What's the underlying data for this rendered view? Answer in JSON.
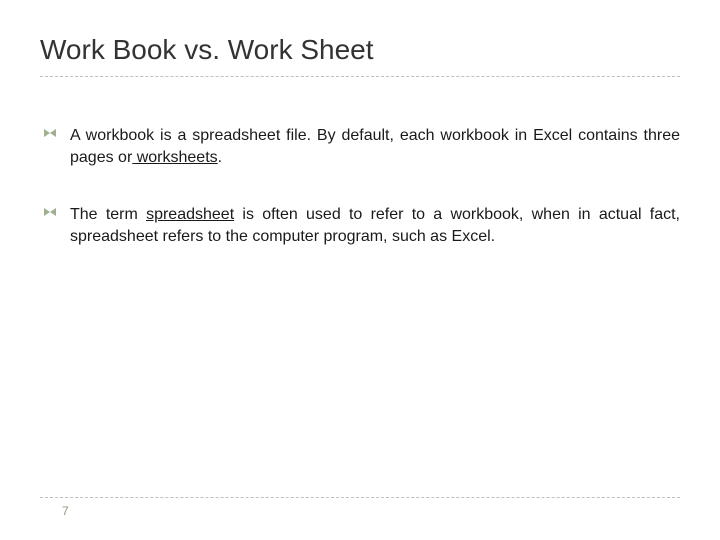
{
  "title": "Work Book vs. Work Sheet",
  "bullets": [
    {
      "pre": "A workbook is a spreadsheet file. By default, each workbook in Excel contains three pages or",
      "link": " worksheets",
      "post": "."
    },
    {
      "pre": "The term ",
      "link": "spreadsheet",
      "post": " is often used to refer to a workbook, when in actual fact, spreadsheet refers to the computer program, such as Excel."
    }
  ],
  "page_number": "7"
}
